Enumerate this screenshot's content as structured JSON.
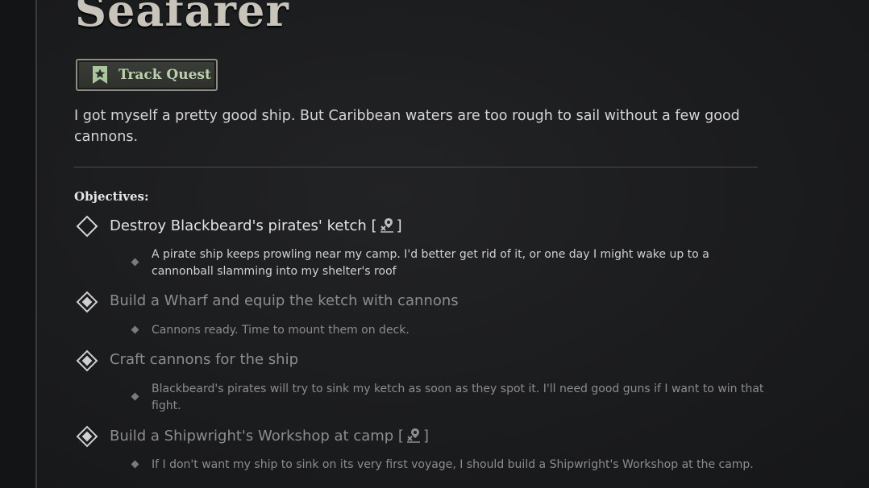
{
  "quest": {
    "title": "Seafarer",
    "track_button_label": "Track Quest",
    "description": "I got myself a pretty good ship. But Caribbean waters are too rough to sail without a few good cannons.",
    "objectives_heading": "Objectives:",
    "objectives": [
      {
        "title_pre": "Destroy Blackbeard's pirates' ketch [",
        "title_post": "]",
        "has_icon": true,
        "state": "active",
        "note": "A pirate ship keeps prowling near my camp. I'd better get rid of it, or one day I might wake up to a cannonball slamming into my shelter's roof"
      },
      {
        "title_pre": "Build a Wharf and equip the ketch with cannons",
        "title_post": "",
        "has_icon": false,
        "state": "done",
        "note": "Cannons ready. Time to mount them on deck."
      },
      {
        "title_pre": "Craft cannons for the ship",
        "title_post": "",
        "has_icon": false,
        "state": "done",
        "note": "Blackbeard's pirates will try to sink my ketch as soon as they spot it. I'll need good guns if I want to win that fight."
      },
      {
        "title_pre": "Build a Shipwright's Workshop at camp [",
        "title_post": "]",
        "has_icon": true,
        "state": "done",
        "note": "If I don't want my ship to sink on its very first voyage, I should build a Shipwright's Workshop at the camp."
      }
    ],
    "icons": {
      "track": "bookmark-star-icon",
      "objective_active": "diamond-outline-icon",
      "objective_done": "diamond-filled-icon",
      "location": "map-pin-icon"
    },
    "colors": {
      "accent_green": "#b9d2a8",
      "text_primary": "#e2e2e2",
      "text_completed": "#8d8d8d"
    }
  }
}
